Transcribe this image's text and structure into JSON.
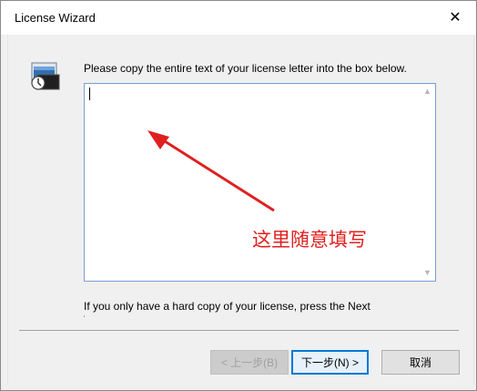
{
  "window": {
    "title": "License Wizard",
    "close_glyph": "✕"
  },
  "main": {
    "instruction": "Please copy the entire text of your license letter into the box below.",
    "license_text": "",
    "annotation": "这里随意填写",
    "footer_note": "If you only have a hard copy of your license, press the Next",
    "footer_clip": "'"
  },
  "scroll": {
    "up_glyph": "▲",
    "down_glyph": "▼"
  },
  "buttons": {
    "back": "< 上一步(B)",
    "next": "下一步(N) >",
    "cancel": "取消"
  },
  "colors": {
    "annotation": "#e02020",
    "accent": "#0078d7"
  },
  "icons": {
    "wizard": "license-wizard-icon",
    "close": "close-icon",
    "arrow": "red-arrow-annotation"
  }
}
